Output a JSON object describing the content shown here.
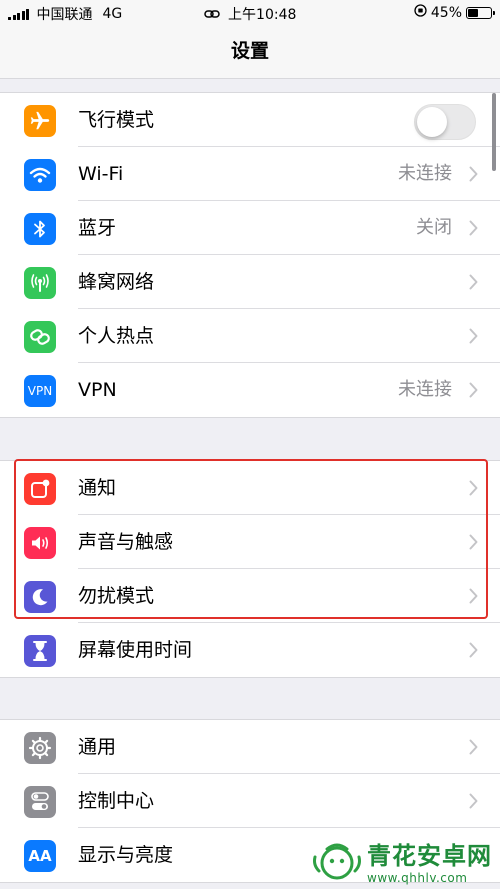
{
  "status_bar": {
    "carrier": "中国联通",
    "network": "4G",
    "time": "上午10:48",
    "battery_percent": "45%",
    "battery_level": 0.45
  },
  "nav": {
    "title": "设置"
  },
  "groups": [
    {
      "items": [
        {
          "label": "飞行模式",
          "icon": "airplane-icon",
          "color": "#ff9500",
          "control": "toggle",
          "toggle_on": false
        },
        {
          "label": "Wi-Fi",
          "icon": "wifi-icon",
          "color": "#0a7aff",
          "value": "未连接"
        },
        {
          "label": "蓝牙",
          "icon": "bluetooth-icon",
          "color": "#0a7aff",
          "value": "关闭"
        },
        {
          "label": "蜂窝网络",
          "icon": "antenna-icon",
          "color": "#34c759",
          "value": ""
        },
        {
          "label": "个人热点",
          "icon": "hotspot-link-icon",
          "color": "#34c759",
          "value": ""
        },
        {
          "label": "VPN",
          "icon": "vpn-icon",
          "icon_text": "VPN",
          "color": "#0a7aff",
          "value": "未连接"
        }
      ]
    },
    {
      "items": [
        {
          "label": "通知",
          "icon": "notifications-icon",
          "color": "#ff3b30",
          "value": ""
        },
        {
          "label": "声音与触感",
          "icon": "speaker-icon",
          "color": "#ff2d55",
          "value": ""
        },
        {
          "label": "勿扰模式",
          "icon": "moon-icon",
          "color": "#5856d6",
          "value": ""
        },
        {
          "label": "屏幕使用时间",
          "icon": "hourglass-icon",
          "color": "#5856d6",
          "value": ""
        }
      ]
    },
    {
      "items": [
        {
          "label": "通用",
          "icon": "gear-icon",
          "color": "#8e8e93",
          "value": ""
        },
        {
          "label": "控制中心",
          "icon": "switches-icon",
          "color": "#8e8e93",
          "value": ""
        },
        {
          "label": "显示与亮度",
          "icon": "text-size-icon",
          "icon_text": "AA",
          "color": "#0a7aff",
          "value": ""
        }
      ]
    }
  ],
  "watermark": {
    "name": "青花安卓网",
    "url": "www.qhhlv.com"
  },
  "colors": {
    "highlight": "#e0302a",
    "chevron": "#c4c4c7",
    "value_text": "#8e8e93"
  }
}
